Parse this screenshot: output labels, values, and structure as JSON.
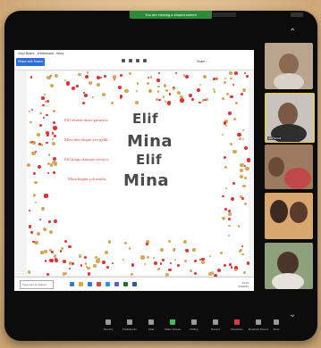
{
  "window": {
    "status_banner": "You are viewing a shared screen",
    "status_extra": "View Options"
  },
  "whiteboard": {
    "title": "Vinyl Board - Whiteboard - Work",
    "share_button": "Share with Teams",
    "right_label": "Share  ...",
    "sentences": [
      "Elif okulda derse gitmiyor.",
      "Mina dün akşam eve geldi.",
      "Elif kitap okumayı seviyor.",
      "Mina bugün çok mutlu."
    ],
    "handwriting": [
      "Elif",
      "Mina",
      "Elif",
      "Mina"
    ],
    "colors": {
      "accent": "#2f6fd6",
      "dot_red": "#e53030",
      "dot_gold": "#d4a65a",
      "sentence": "#e0452f"
    }
  },
  "taskbar": {
    "search_placeholder": "Type here to search",
    "time": "11:42",
    "date": "2/3/2021"
  },
  "participants": [
    {
      "name": ""
    },
    {
      "name": "Ali Pamuk"
    },
    {
      "name": ""
    },
    {
      "name": ""
    },
    {
      "name": ""
    }
  ],
  "toolbar": {
    "items": [
      {
        "label": "Security",
        "icon": "shield-icon"
      },
      {
        "label": "Participants",
        "icon": "people-icon"
      },
      {
        "label": "Chat",
        "icon": "chat-icon"
      },
      {
        "label": "Share Screen",
        "icon": "share-screen-icon"
      },
      {
        "label": "Polling",
        "icon": "poll-icon"
      },
      {
        "label": "Record",
        "icon": "record-icon"
      },
      {
        "label": "Reactions",
        "icon": "reaction-icon"
      },
      {
        "label": "Breakout Rooms",
        "icon": "breakout-icon"
      },
      {
        "label": "More",
        "icon": "more-icon"
      }
    ]
  }
}
